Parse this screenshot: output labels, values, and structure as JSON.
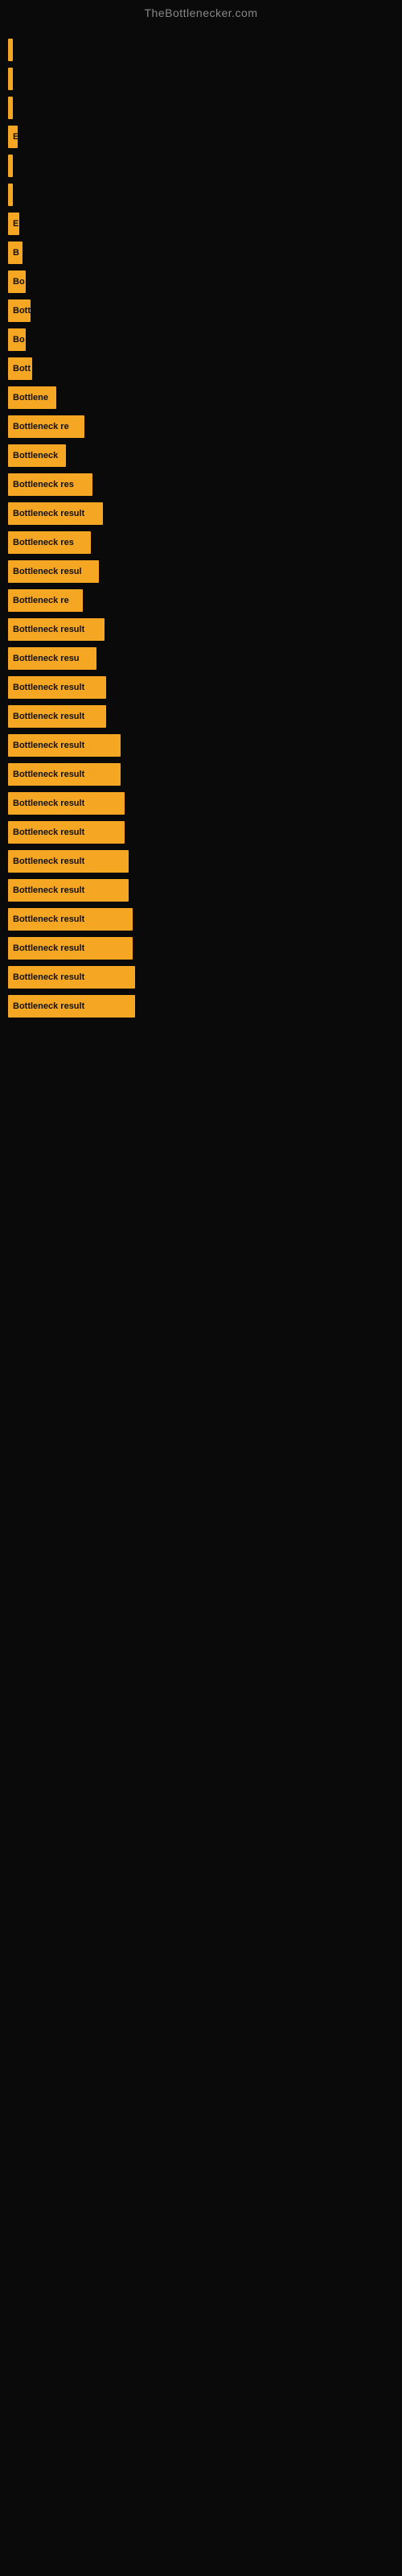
{
  "site": {
    "title": "TheBottlenecker.com"
  },
  "bars": [
    {
      "label": "|",
      "width": 4
    },
    {
      "label": "|",
      "width": 6
    },
    {
      "label": "|",
      "width": 6
    },
    {
      "label": "E",
      "width": 12
    },
    {
      "label": "|",
      "width": 6
    },
    {
      "label": "|",
      "width": 6
    },
    {
      "label": "E",
      "width": 14
    },
    {
      "label": "B",
      "width": 18
    },
    {
      "label": "Bo",
      "width": 22
    },
    {
      "label": "Bott",
      "width": 28
    },
    {
      "label": "Bo",
      "width": 22
    },
    {
      "label": "Bott",
      "width": 30
    },
    {
      "label": "Bottlene",
      "width": 60
    },
    {
      "label": "Bottleneck re",
      "width": 95
    },
    {
      "label": "Bottleneck",
      "width": 72
    },
    {
      "label": "Bottleneck res",
      "width": 105
    },
    {
      "label": "Bottleneck result",
      "width": 118
    },
    {
      "label": "Bottleneck res",
      "width": 103
    },
    {
      "label": "Bottleneck resul",
      "width": 113
    },
    {
      "label": "Bottleneck re",
      "width": 93
    },
    {
      "label": "Bottleneck result",
      "width": 120
    },
    {
      "label": "Bottleneck resu",
      "width": 110
    },
    {
      "label": "Bottleneck result",
      "width": 122
    },
    {
      "label": "Bottleneck result",
      "width": 122
    },
    {
      "label": "Bottleneck result",
      "width": 140
    },
    {
      "label": "Bottleneck result",
      "width": 140
    },
    {
      "label": "Bottleneck result",
      "width": 145
    },
    {
      "label": "Bottleneck result",
      "width": 145
    },
    {
      "label": "Bottleneck result",
      "width": 150
    },
    {
      "label": "Bottleneck result",
      "width": 150
    },
    {
      "label": "Bottleneck result",
      "width": 155
    },
    {
      "label": "Bottleneck result",
      "width": 155
    },
    {
      "label": "Bottleneck result",
      "width": 158
    },
    {
      "label": "Bottleneck result",
      "width": 158
    }
  ]
}
